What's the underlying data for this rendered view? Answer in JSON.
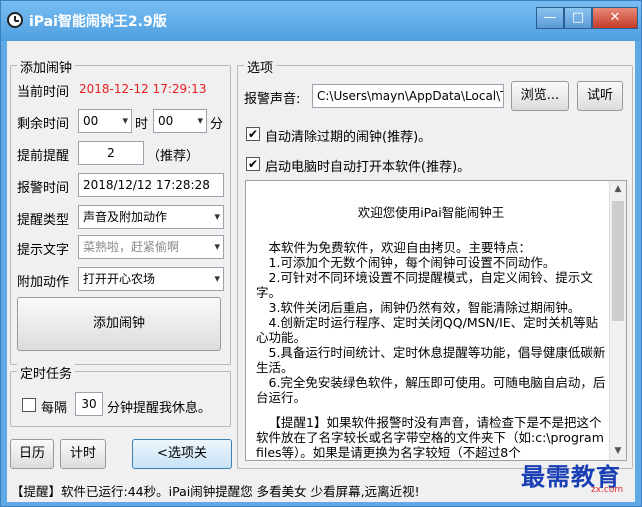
{
  "window": {
    "title": "iPai智能闹钟王2.9版"
  },
  "add_alarm": {
    "group_title": "添加闹钟",
    "current_time_label": "当前时间",
    "current_time_value": "2018-12-12 17:29:13",
    "remaining_label": "剩余时间",
    "hour_value": "00",
    "hour_unit": "时",
    "minute_value": "00",
    "minute_unit": "分",
    "advance_label": "提前提醒",
    "advance_value": "2",
    "advance_note": "（推荐）",
    "alarm_time_label": "报警时间",
    "alarm_time_value": "2018/12/12 17:28:28",
    "type_label": "提醒类型",
    "type_value": "声音及附加动作",
    "prompt_label": "提示文字",
    "prompt_placeholder": "菜熟啦，赶紧偷啊",
    "action_label": "附加动作",
    "action_value": "打开开心农场",
    "add_button": "添加闹钟"
  },
  "scheduled": {
    "group_title": "定时任务",
    "every_label": "每隔",
    "interval_value": "30",
    "interval_suffix": "分钟提醒我休息。"
  },
  "bottom_buttons": {
    "calendar": "日历",
    "timer": "计时",
    "options_toggle": "<选项关"
  },
  "options": {
    "group_title": "选项",
    "sound_label": "报警声音:",
    "sound_path": "C:\\Users\\mayn\\AppData\\Local\\T",
    "browse_button": "浏览...",
    "test_button": "试听",
    "auto_clear_label": "自动清除过期的闹钟(推荐)。",
    "auto_start_label": "启动电脑时自动打开本软件(推荐)。",
    "auto_clear_checked": true,
    "auto_start_checked": true
  },
  "intro": {
    "title": "欢迎您使用iPai智能闹钟王",
    "lines": [
      "本软件为免费软件，欢迎自由拷贝。主要特点：",
      "1.可添加个无数个闹钟，每个闹钟可设置不同动作。",
      "2.可针对不同环境设置不同提醒模式，自定义闹铃、提示文字。",
      "3.软件关闭后重启，闹钟仍然有效，智能清除过期闹钟。",
      "4.创新定时运行程序、定时关闭QQ/MSN/IE、定时关机等贴心功能。",
      "5.具备运行时间统计、定时休息提醒等功能，倡导健康低碳新生活。",
      "6.完全免安装绿色软件，解压即可使用。可随电脑自启动，后台运行。"
    ],
    "tip": "【提醒1】如果软件报警时没有声音，请检查下是不是把这个软件放在了名字较长或名字带空格的文件夹下（如:c:\\program files等）。如果是请更换为名字较短（不超过8个"
  },
  "status": {
    "text": "【提醒】软件已运行:44秒。iPai闹钟提醒您 多看美女 少看屏幕,远离近视!"
  },
  "watermark": {
    "main": "最需教育",
    "sub": "zx.com"
  }
}
